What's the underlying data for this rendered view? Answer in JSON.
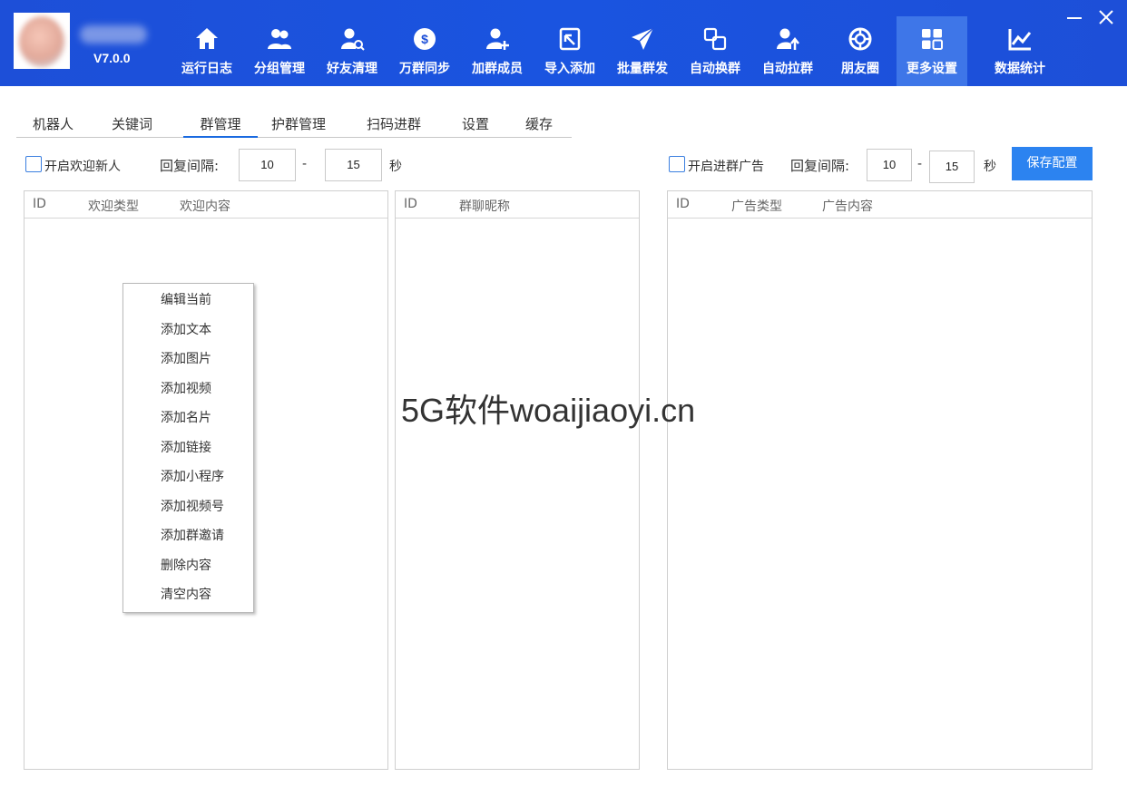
{
  "header": {
    "version": "V7.0.0",
    "nav": [
      {
        "label": "运行日志",
        "icon": "home-icon"
      },
      {
        "label": "分组管理",
        "icon": "users-icon"
      },
      {
        "label": "好友清理",
        "icon": "user-search-icon"
      },
      {
        "label": "万群同步",
        "icon": "sync-icon"
      },
      {
        "label": "加群成员",
        "icon": "user-add-icon"
      },
      {
        "label": "导入添加",
        "icon": "import-icon"
      },
      {
        "label": "批量群发",
        "icon": "send-icon"
      },
      {
        "label": "自动换群",
        "icon": "switch-group-icon"
      },
      {
        "label": "自动拉群",
        "icon": "user-up-icon"
      },
      {
        "label": "朋友圈",
        "icon": "moments-icon"
      },
      {
        "label": "更多设置",
        "icon": "grid-icon"
      },
      {
        "label": "数据统计",
        "icon": "chart-icon"
      }
    ],
    "active_nav": "更多设置"
  },
  "tabs": [
    "机器人",
    "关键词",
    "群管理",
    "护群管理",
    "扫码进群",
    "设置",
    "缓存"
  ],
  "active_tab": "群管理",
  "welcome": {
    "checkbox_label": "开启欢迎新人",
    "interval_label": "回复间隔:",
    "min": "10",
    "dash": "-",
    "max": "15",
    "unit": "秒"
  },
  "ad": {
    "checkbox_label": "开启进群广告",
    "interval_label": "回复间隔:",
    "min": "10",
    "dash": "-",
    "max": "15",
    "unit": "秒"
  },
  "save_button": "保存配置",
  "lists": {
    "welcome": {
      "columns": [
        "ID",
        "欢迎类型",
        "欢迎内容"
      ]
    },
    "groups": {
      "columns": [
        "ID",
        "群聊昵称"
      ]
    },
    "ads": {
      "columns": [
        "ID",
        "广告类型",
        "广告内容"
      ]
    }
  },
  "context_menu": [
    "编辑当前",
    "添加文本",
    "添加图片",
    "添加视频",
    "添加名片",
    "添加链接",
    "添加小程序",
    "添加视频号",
    "添加群邀请",
    "删除内容",
    "清空内容"
  ],
  "watermark": "5G软件woaijiaoyi.cn"
}
